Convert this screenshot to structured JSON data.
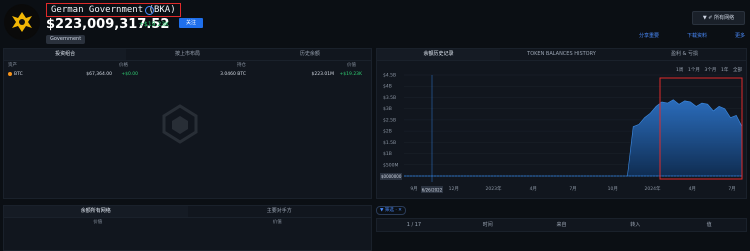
{
  "header": {
    "entity_name": "German Government (BKA)",
    "value": "$223,009,317.52",
    "delta": "+$19.23K",
    "follow_label": "关注",
    "tag": "Government",
    "top_right_button": "▼ ✐ 所有网络",
    "top_links": [
      "分享重要",
      "下载资料",
      "更多"
    ]
  },
  "left_panel": {
    "tabs": [
      "投资组合",
      "按上市布局",
      "历史余额"
    ],
    "columns": [
      "资产",
      "价格",
      "持仓",
      "价值"
    ],
    "rows": [
      {
        "asset": "BTC",
        "price": "$67,364.00",
        "price_change": "+$0.00",
        "holding": "3.0460 BTC",
        "value": "$223.01M",
        "value_change": "+$19.23K"
      }
    ]
  },
  "bottom_left_panel": {
    "tabs": [
      "余额所有网络",
      "主要对手方"
    ],
    "col_a": "价值",
    "col_b": "价值"
  },
  "chart_panel": {
    "tabs": [
      "余额历史记录",
      "TOKEN BALANCES HISTORY",
      "盈利 & 亏损"
    ],
    "range_buttons": [
      "1周",
      "1个月",
      "3个月",
      "1年",
      "全部"
    ],
    "date_badge": "6/26/2022",
    "left_badge": "$0000000"
  },
  "chart_data": {
    "type": "area",
    "y_ticks": [
      "$4.5B",
      "$4B",
      "$3.5B",
      "$3B",
      "$2.5B",
      "$2B",
      "$1.5B",
      "$1B",
      "$500M",
      "$0"
    ],
    "x_ticks": [
      "9月",
      "12月",
      "2023年",
      "4月",
      "7月",
      "10月",
      "2024年",
      "4月",
      "7月"
    ],
    "ylim": [
      0,
      4500000000
    ],
    "values": [
      0,
      0,
      0,
      0,
      0,
      0,
      0,
      0,
      0,
      0,
      0,
      0,
      0,
      0,
      0,
      0,
      0,
      0,
      0,
      0,
      0,
      0,
      0,
      0,
      0,
      0,
      0,
      0,
      0,
      0,
      0,
      0,
      0,
      0,
      0,
      0,
      0,
      0,
      0,
      0,
      2200000000,
      2300000000,
      2600000000,
      2800000000,
      3100000000,
      3300000000,
      3250000000,
      3400000000,
      3200000000,
      3350000000,
      3300000000,
      3100000000,
      3250000000,
      3200000000,
      2900000000,
      3100000000,
      3000000000,
      2600000000,
      2700000000,
      2200000000
    ]
  },
  "tx_bar": {
    "filter_label": "▼ 筛选 · ✕",
    "pages": "1 / 17",
    "tabs": [
      "时间",
      "来自",
      "转入",
      "值"
    ]
  }
}
